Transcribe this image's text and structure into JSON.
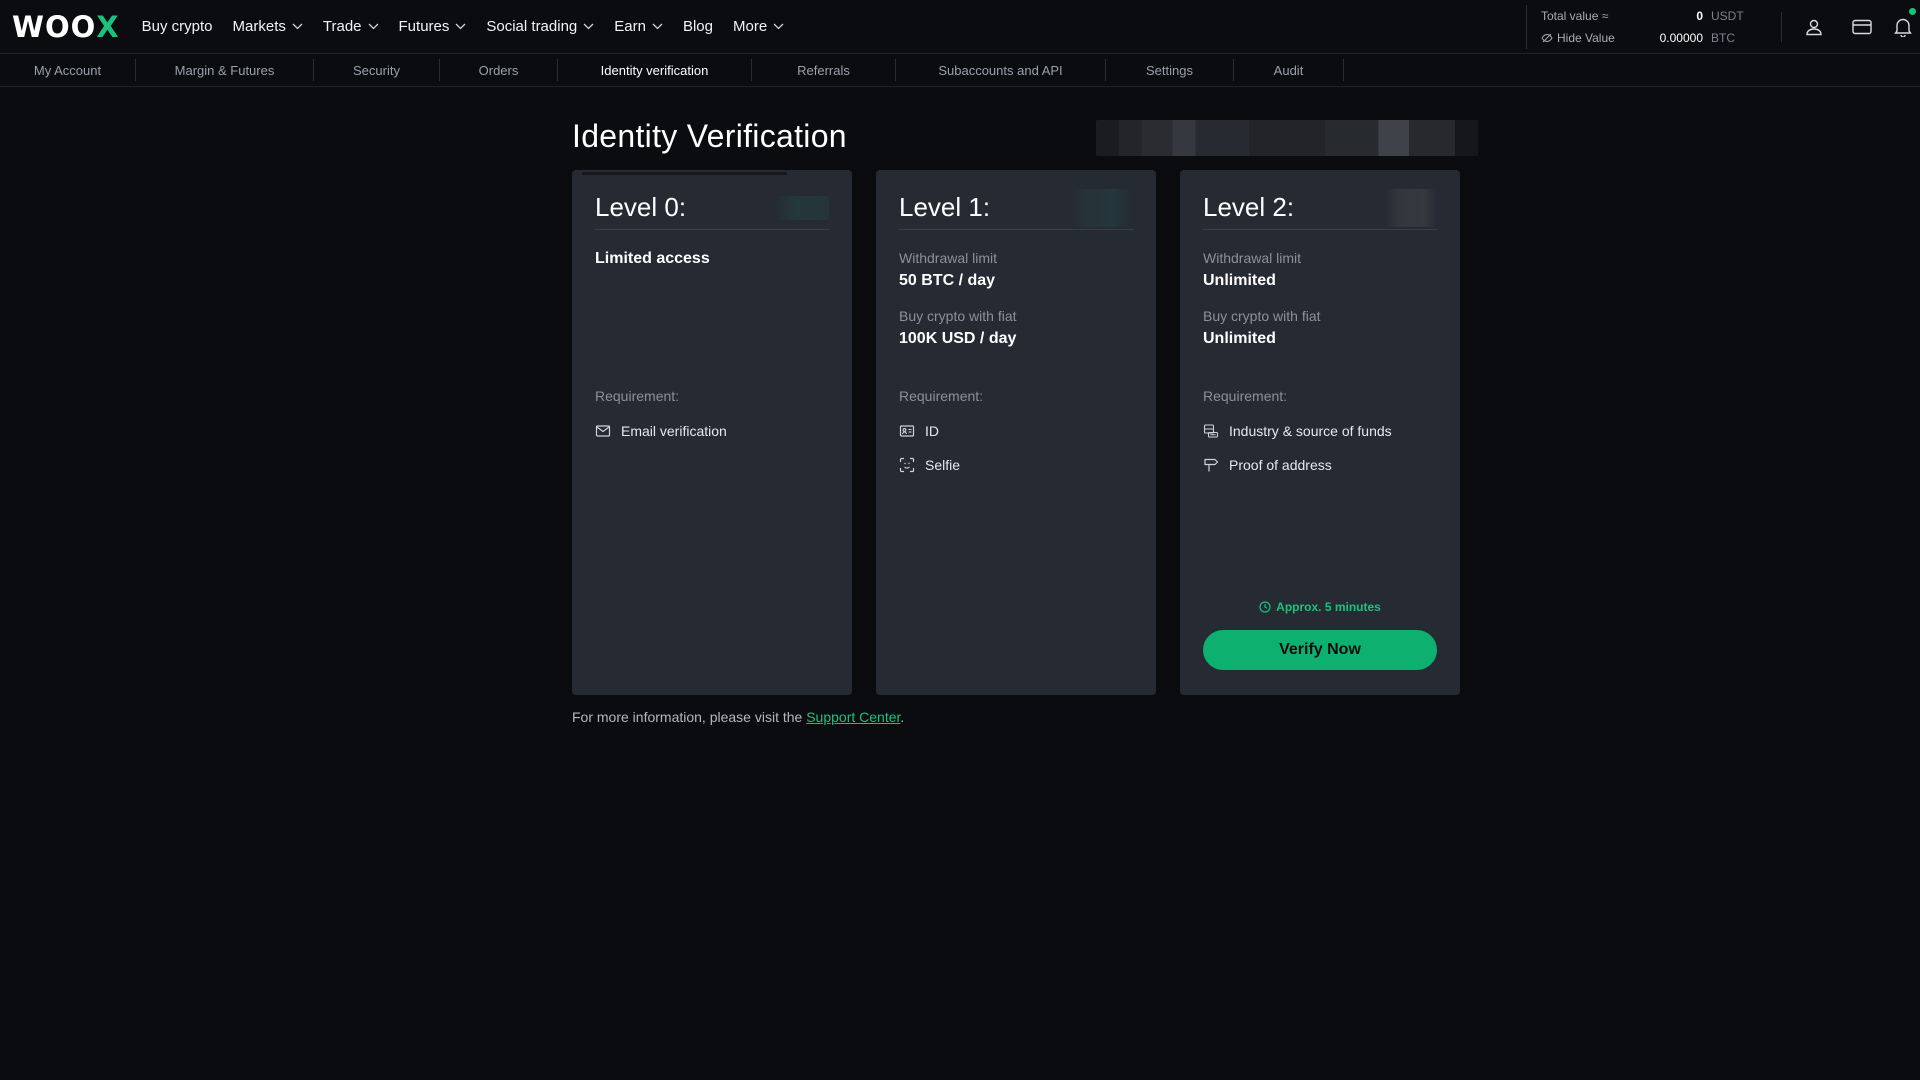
{
  "logo": {
    "text_main": "WOO",
    "text_accent": "X"
  },
  "topnav": {
    "items": [
      {
        "label": "Buy crypto",
        "dropdown": false
      },
      {
        "label": "Markets",
        "dropdown": true
      },
      {
        "label": "Trade",
        "dropdown": true
      },
      {
        "label": "Futures",
        "dropdown": true
      },
      {
        "label": "Social trading",
        "dropdown": true
      },
      {
        "label": "Earn",
        "dropdown": true
      },
      {
        "label": "Blog",
        "dropdown": false
      },
      {
        "label": "More",
        "dropdown": true
      }
    ]
  },
  "wallet": {
    "total_value_label": "Total value ≈",
    "total_value": "0",
    "total_value_currency": "USDT",
    "hide_value_label": "Hide Value",
    "btc_value": "0.00000",
    "btc_currency": "BTC"
  },
  "subnav": {
    "tabs": [
      {
        "label": "My Account",
        "active": false
      },
      {
        "label": "Margin & Futures",
        "active": false
      },
      {
        "label": "Security",
        "active": false
      },
      {
        "label": "Orders",
        "active": false
      },
      {
        "label": "Identity verification",
        "active": true
      },
      {
        "label": "Referrals",
        "active": false
      },
      {
        "label": "Subaccounts and API",
        "active": false
      },
      {
        "label": "Settings",
        "active": false
      },
      {
        "label": "Audit",
        "active": false
      }
    ]
  },
  "page": {
    "title": "Identity Verification"
  },
  "levels": [
    {
      "title": "Level 0:",
      "summary": "Limited access",
      "requirement_label": "Requirement:",
      "requirements": [
        {
          "label": "Email verification",
          "icon": "mail-icon"
        }
      ]
    },
    {
      "title": "Level 1:",
      "limits": [
        {
          "label": "Withdrawal limit",
          "value": "50 BTC / day"
        },
        {
          "label": "Buy crypto with fiat",
          "value": "100K USD / day"
        }
      ],
      "requirement_label": "Requirement:",
      "requirements": [
        {
          "label": "ID",
          "icon": "id-card-icon"
        },
        {
          "label": "Selfie",
          "icon": "face-scan-icon"
        }
      ]
    },
    {
      "title": "Level 2:",
      "limits": [
        {
          "label": "Withdrawal limit",
          "value": "Unlimited"
        },
        {
          "label": "Buy crypto with fiat",
          "value": "Unlimited"
        }
      ],
      "requirement_label": "Requirement:",
      "requirements": [
        {
          "label": "Industry & source of funds",
          "icon": "coins-icon"
        },
        {
          "label": "Proof of address",
          "icon": "signpost-icon"
        }
      ],
      "approx_time": "Approx. 5 minutes",
      "cta": "Verify Now"
    }
  ],
  "footer": {
    "text": "For more information, please visit the ",
    "link_text": "Support Center",
    "suffix": "."
  },
  "colors": {
    "accent": "#19c37d",
    "button": "#0eb06f",
    "card_bg": "#262a33",
    "page_bg": "#0b0c0f"
  }
}
